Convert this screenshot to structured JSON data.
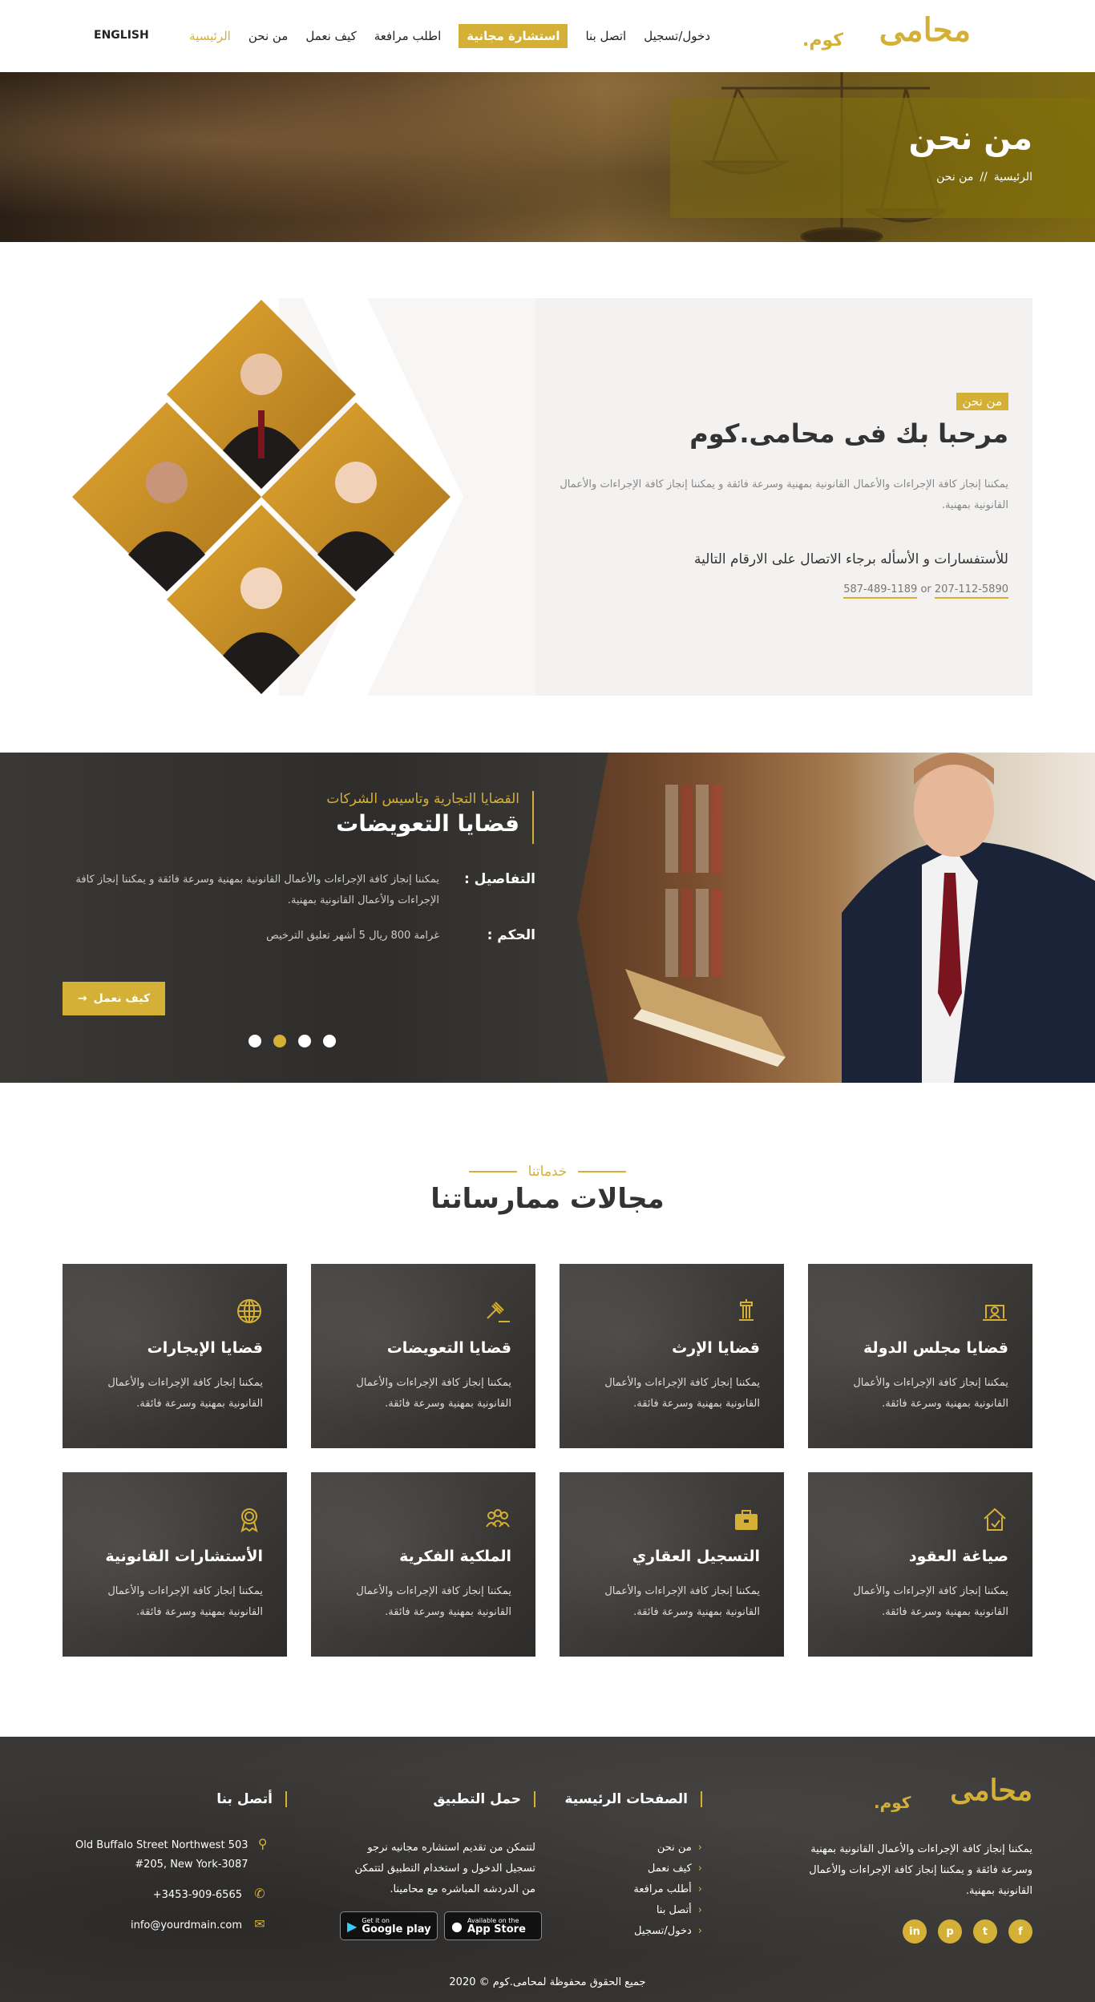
{
  "nav": {
    "logo_text": "محامى",
    "logo_suffix": ".كوم",
    "items": [
      {
        "label": "الرئيسية",
        "active": true
      },
      {
        "label": "من نحن"
      },
      {
        "label": "كيف نعمل"
      },
      {
        "label": "اطلب مرافعة"
      },
      {
        "label": "استشارة مجانية",
        "highlight": true
      },
      {
        "label": "اتصل بنا"
      },
      {
        "label": "دخول/تسجيل"
      }
    ],
    "language": "ENGLISH"
  },
  "hero": {
    "title": "من نحن",
    "breadcrumb_home": "الرئيسية",
    "breadcrumb_sep": "//",
    "breadcrumb_current": "من نحن"
  },
  "about": {
    "tag": "من نحن",
    "heading": "مرحبا بك فى محامى.كوم",
    "description": "يمكننا إنجاز كافة الإجراءات والأعمال القانونية بمهنية وسرعة فائقة و يمكننا إنجاز كافة الإجراءات والأعمال القانونية بمهنية.",
    "inquiry": "للأستفسارات و الأسأله برجاء الاتصال على الارقام التالية",
    "phone1": "207-112-5890",
    "phone_or": "or",
    "phone2": "587-489-1189"
  },
  "slider": {
    "subtitle": "القضايا التجارية وتاسيس الشركات",
    "title": "قضايا التعويضات",
    "details_label": "التفاصيل :",
    "details_value": "يمكننا إنجاز كافة الإجراءات والأعمال القانونية بمهنية وسرعة فائقة و يمكننا إنجاز كافة الإجراءات والأعمال القانونية بمهنية.",
    "verdict_label": "الحكم :",
    "verdict_value": "غرامة 800 ريال 5 أشهر تعليق الترخيص",
    "button": "كيف نعمل",
    "active_slide": 2,
    "slide_count": 4
  },
  "practice": {
    "eyebrow": "خدماتنا",
    "heading": "مجالات ممارساتنا",
    "cards": [
      {
        "title": "قضايا مجلس الدولة",
        "text": "يمكننا إنجاز كافة الإجراءات والأعمال القانونية بمهنية وسرعة فائقة.",
        "icon": "laptop-lawyer-icon"
      },
      {
        "title": "قضايا الإرث",
        "text": "يمكننا إنجاز كافة الإجراءات والأعمال القانونية بمهنية وسرعة فائقة.",
        "icon": "pillar-icon"
      },
      {
        "title": "قضايا التعويضات",
        "text": "يمكننا إنجاز كافة الإجراءات والأعمال القانونية بمهنية وسرعة فائقة.",
        "icon": "gavel-icon"
      },
      {
        "title": "قضايا الإيجارات",
        "text": "يمكننا إنجاز كافة الإجراءات والأعمال القانونية بمهنية وسرعة فائقة.",
        "icon": "globe-icon"
      },
      {
        "title": "صياغة العقود",
        "text": "يمكننا إنجاز كافة الإجراءات والأعمال القانونية بمهنية وسرعة فائقة.",
        "icon": "home-contract-icon"
      },
      {
        "title": "التسجيل العقاري",
        "text": "يمكننا إنجاز كافة الإجراءات والأعمال القانونية بمهنية وسرعة فائقة.",
        "icon": "briefcase-icon"
      },
      {
        "title": "الملكية الفكرية",
        "text": "يمكننا إنجاز كافة الإجراءات والأعمال القانونية بمهنية وسرعة فائقة.",
        "icon": "team-icon"
      },
      {
        "title": "الأستشارات القانونية",
        "text": "يمكننا إنجاز كافة الإجراءات والأعمال القانونية بمهنية وسرعة فائقة.",
        "icon": "award-icon"
      }
    ]
  },
  "footer": {
    "logo_text": "محامى",
    "logo_suffix": ".كوم",
    "description": "يمكننا إنجاز كافة الإجراءات والأعمال القانونية بمهنية وسرعة فائقة و يمكننا إنجاز كافة الإجراءات والأعمال القانونية بمهنية.",
    "social": [
      "f",
      "t",
      "p",
      "in"
    ],
    "pages_title": "الصفحات الرئيسية",
    "pages": [
      "من نحن",
      "كيف نعمل",
      "أطلب مرافعة",
      "أتصل بنا",
      "دخول/تسجيل"
    ],
    "app_title": "حمل التطبيق",
    "app_text": "لتتمكن من تقديم استشاره مجانيه نرجو تسجيل الدخول و استخدام التطبيق لتتمكن من الدردشه المباشره مع محامينا.",
    "google_small": "Get it on",
    "google_big": "Google play",
    "apple_small": "Available on the",
    "apple_big": "App Store",
    "contact_title": "أتصل بنا",
    "address": "Old Buffalo Street Northwest 503 #205, New York-3087",
    "phone": "+3453-909-6565",
    "email": "info@yourdmain.com",
    "copyright": "جميع الحقوق محفوظة لمحامى.كوم © 2020"
  },
  "colors": {
    "accent": "#d4b036",
    "dark": "#3a3836"
  }
}
